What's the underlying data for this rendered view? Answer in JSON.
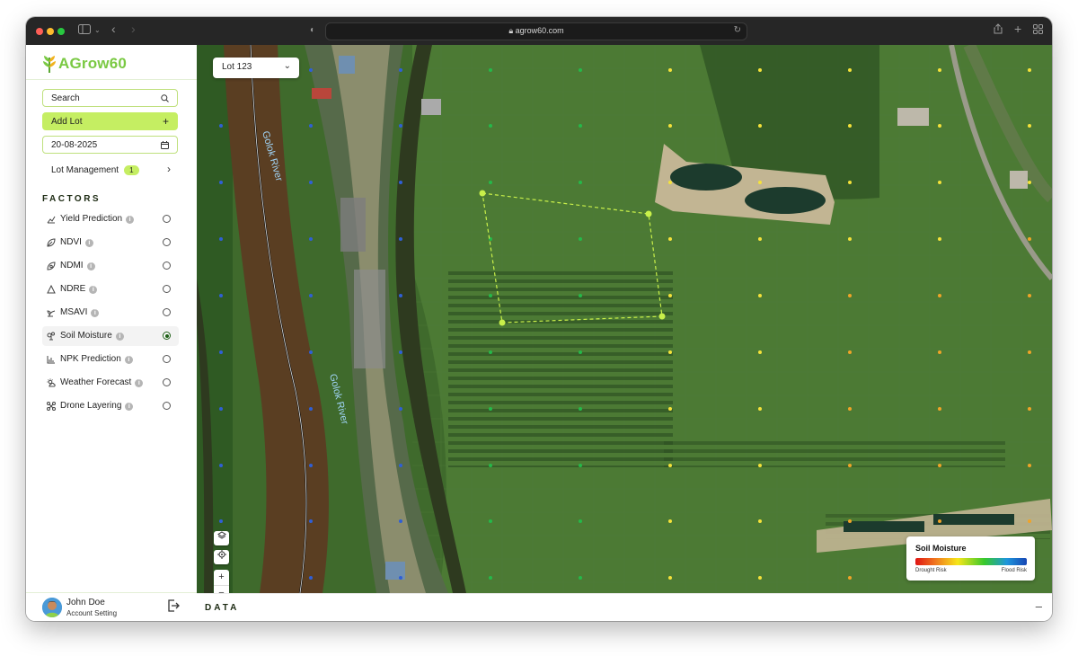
{
  "browser": {
    "url": "agrow60.com",
    "traffic_lights": [
      "#fe5f57",
      "#febc2e",
      "#28c840"
    ]
  },
  "brand": {
    "name": "AGrow60",
    "accent": "#c5ee62",
    "logo_color": "#7ac943"
  },
  "sidebar": {
    "search_label": "Search",
    "add_lot_label": "Add Lot",
    "date_value": "20-08-2025",
    "lot_management": {
      "label": "Lot Management",
      "count": "1"
    },
    "factors_heading": "FACTORS",
    "factors": [
      {
        "label": "Yield Prediction",
        "icon": "chart-icon",
        "selected": false
      },
      {
        "label": "NDVI",
        "icon": "leaf-icon",
        "selected": false
      },
      {
        "label": "NDMI",
        "icon": "leaf-drop-icon",
        "selected": false
      },
      {
        "label": "NDRE",
        "icon": "triangle-icon",
        "selected": false
      },
      {
        "label": "MSAVI",
        "icon": "sprout-icon",
        "selected": false
      },
      {
        "label": "Soil Moisture",
        "icon": "moisture-icon",
        "selected": true
      },
      {
        "label": "NPK Prediction",
        "icon": "bar-chart-icon",
        "selected": false
      },
      {
        "label": "Weather Forecast",
        "icon": "sun-cloud-icon",
        "selected": false
      },
      {
        "label": "Drone Layering",
        "icon": "drone-icon",
        "selected": false
      }
    ]
  },
  "user": {
    "name": "John Doe",
    "subtitle": "Account Setting"
  },
  "map": {
    "lot_select": "Lot 123",
    "river_label_1": "Golok River",
    "river_label_2": "Golok River",
    "legend": {
      "title": "Soil Moisture",
      "low_label": "Drought Risk",
      "high_label": "Flood Risk"
    },
    "dot_colors": {
      "blue": "#2f5fd6",
      "green": "#25b84a",
      "yellow": "#f5e23a",
      "orange": "#f0a428"
    },
    "polygon_color": "#c9f04a"
  },
  "bottom_panel": {
    "label": "DATA",
    "collapse": "–"
  }
}
